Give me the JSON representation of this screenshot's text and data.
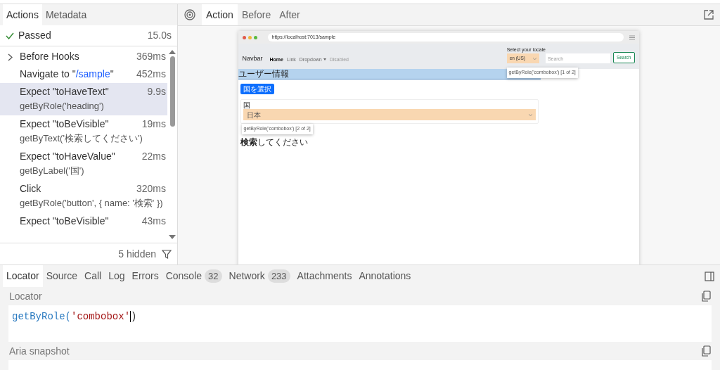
{
  "sidebar": {
    "tabs": [
      {
        "label": "Actions",
        "selected": true
      },
      {
        "label": "Metadata",
        "selected": false
      }
    ],
    "status": {
      "label": "Passed",
      "duration": "15.0s"
    },
    "actions": [
      {
        "kind": "group",
        "title_parts": [
          "Before Hooks"
        ],
        "duration": "369ms",
        "selected": false
      },
      {
        "kind": "navigate",
        "title_parts": [
          "Navigate to \"",
          "/sample",
          "\""
        ],
        "duration": "452ms",
        "selected": false
      },
      {
        "kind": "step",
        "title_parts": [
          "Expect \"toHaveText\""
        ],
        "locator": "getByRole('heading')",
        "duration": "9.9s",
        "selected": true
      },
      {
        "kind": "step",
        "title_parts": [
          "Expect \"toBeVisible\""
        ],
        "locator": "getByText('検索してください')",
        "duration": "19ms",
        "selected": false
      },
      {
        "kind": "step",
        "title_parts": [
          "Expect \"toHaveValue\""
        ],
        "locator": "getByLabel('国')",
        "duration": "22ms",
        "selected": false
      },
      {
        "kind": "step",
        "title_parts": [
          "Click"
        ],
        "locator": "getByRole('button', { name: '検索' })",
        "duration": "320ms",
        "selected": false
      },
      {
        "kind": "step",
        "title_parts": [
          "Expect \"toBeVisible\""
        ],
        "duration": "43ms",
        "selected": false
      }
    ],
    "hidden": "5 hidden"
  },
  "snapshot_tabs": [
    {
      "label": "Action",
      "selected": true
    },
    {
      "label": "Before",
      "selected": false
    },
    {
      "label": "After",
      "selected": false
    }
  ],
  "browser": {
    "url": "https://localhost:7013/sample",
    "navbar": {
      "brand": "Navbar",
      "links": [
        {
          "kind": "link",
          "label": "Home",
          "selected": true,
          "disabled": false
        },
        {
          "kind": "link",
          "label": "Link",
          "selected": false,
          "disabled": false
        },
        {
          "kind": "dropdown",
          "label": "Dropdown",
          "selected": false,
          "disabled": false
        },
        {
          "kind": "link",
          "label": "Disabled",
          "selected": false,
          "disabled": true
        }
      ],
      "locale_label": "Select your locale",
      "locale_value": "en (US)",
      "search_placeholder": "Search",
      "search_button": "Search",
      "tooltip": "getByRole('combobox') [1 of 2]"
    },
    "heading": "ユーザー情報",
    "select_button": "国を選択",
    "field_label": "国",
    "field_value": "日本",
    "tooltip": "getByRole('combobox') [2 of 2]",
    "message": "**検索**してください"
  },
  "bottom_tabs": [
    {
      "label": "Locator",
      "selected": true
    },
    {
      "label": "Source",
      "selected": false
    },
    {
      "label": "Call",
      "selected": false
    },
    {
      "label": "Log",
      "selected": false
    },
    {
      "label": "Errors",
      "selected": false
    },
    {
      "label": "Console",
      "count": "32",
      "selected": false
    },
    {
      "label": "Network",
      "count": "233",
      "selected": false
    },
    {
      "label": "Attachments",
      "selected": false
    },
    {
      "label": "Annotations",
      "selected": false
    }
  ],
  "locator": {
    "label": "Locator",
    "code_fn": "getByRole(",
    "code_arg": "'combobox'",
    "code_end": ")"
  },
  "aria": {
    "label": "Aria snapshot"
  }
}
